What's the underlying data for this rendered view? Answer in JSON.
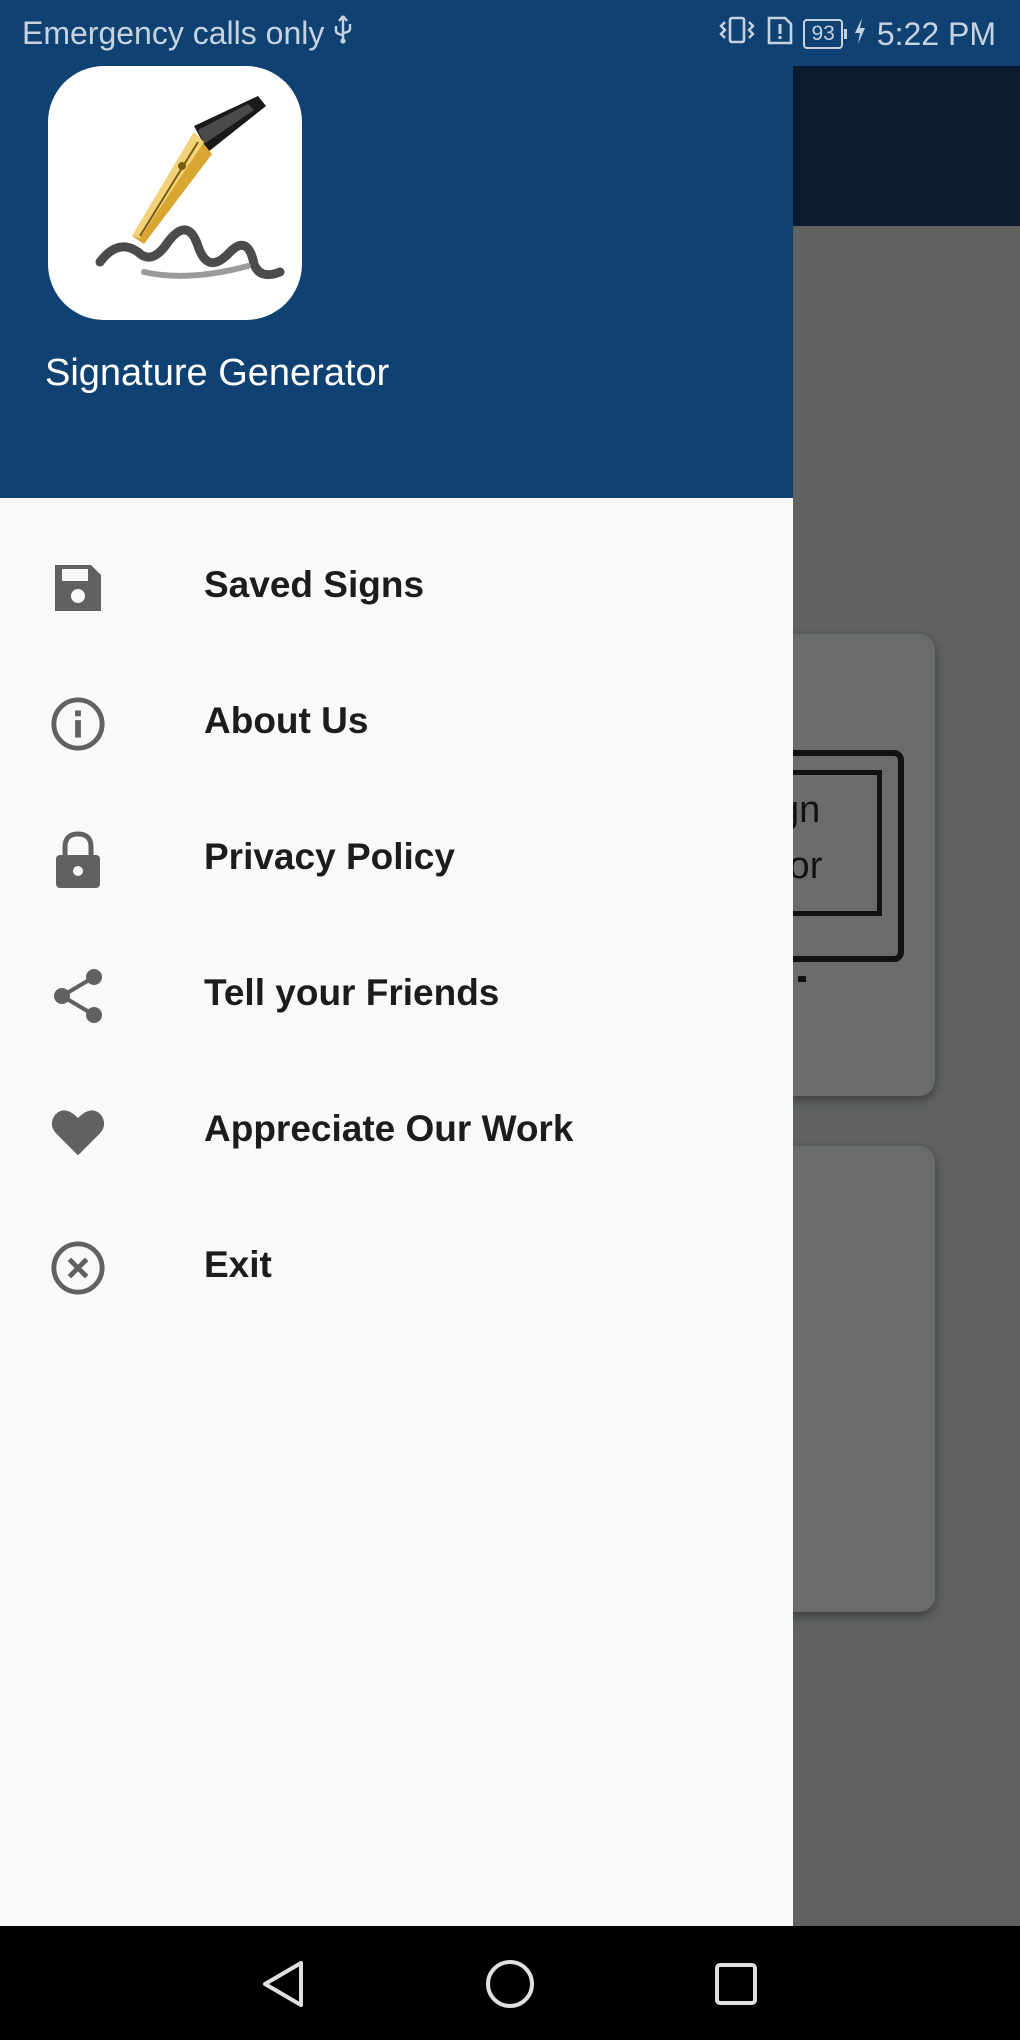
{
  "status_bar": {
    "carrier_text": "Emergency calls only",
    "usb_icon": "usb-icon",
    "vibrate_icon": "vibrate-icon",
    "alert_icon": "alert-icon",
    "battery_level": "93",
    "charging_icon": "bolt-icon",
    "time": "5:22 PM"
  },
  "drawer": {
    "app_name": "Signature Generator",
    "logo_icon": "fountain-pen-signature-logo",
    "header_color": "#0f4173",
    "items": [
      {
        "label": "Saved Signs",
        "icon": "save-icon"
      },
      {
        "label": "About Us",
        "icon": "info-icon"
      },
      {
        "label": "Privacy Policy",
        "icon": "lock-icon"
      },
      {
        "label": "Tell your Friends",
        "icon": "share-icon"
      },
      {
        "label": "Appreciate Our Work",
        "icon": "heart-icon"
      },
      {
        "label": "Exit",
        "icon": "close-circle-icon"
      }
    ]
  },
  "background": {
    "card_text_line1": "gn",
    "card_text_line2": "tor"
  },
  "nav_bar": {
    "back": "back-icon",
    "home": "home-icon",
    "recents": "recents-icon"
  }
}
